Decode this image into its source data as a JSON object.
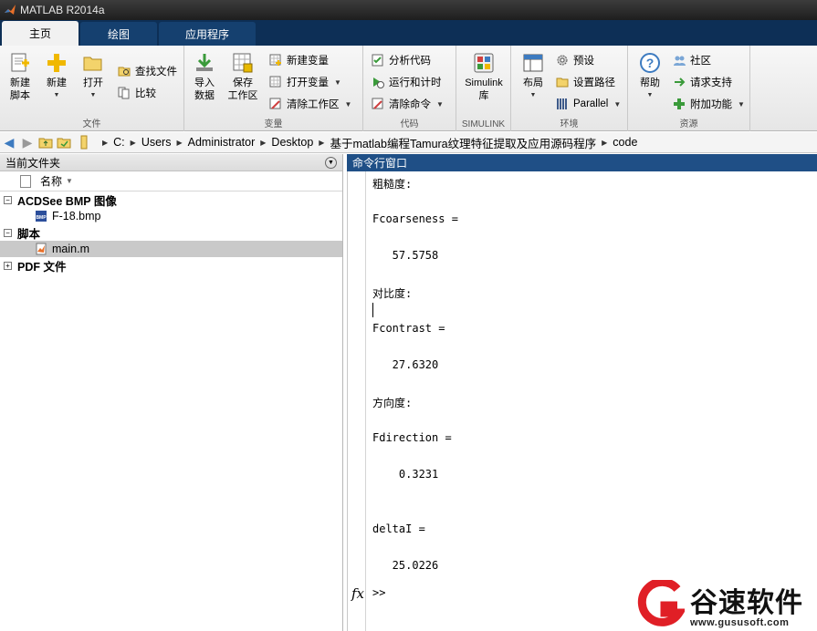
{
  "window": {
    "title": "MATLAB R2014a"
  },
  "tabs": [
    {
      "label": "主页",
      "active": true
    },
    {
      "label": "绘图",
      "active": false
    },
    {
      "label": "应用程序",
      "active": false
    }
  ],
  "ribbon": {
    "file": {
      "label": "文件",
      "new_script": "新建\n脚本",
      "new": "新建",
      "open": "打开",
      "find_files": "查找文件",
      "compare": "比较"
    },
    "variable": {
      "label": "变量",
      "import": "导入\n数据",
      "save_workspace": "保存\n工作区",
      "new_variable": "新建变量",
      "open_variable": "打开变量",
      "clear_workspace": "清除工作区"
    },
    "code": {
      "label": "代码",
      "analyze": "分析代码",
      "run_time": "运行和计时",
      "clear_commands": "清除命令"
    },
    "simulink": {
      "label": "SIMULINK",
      "library": "Simulink\n库"
    },
    "environment": {
      "label": "环境",
      "layout": "布局",
      "preferences": "预设",
      "set_path": "设置路径",
      "parallel": "Parallel"
    },
    "resources": {
      "label": "资源",
      "help": "帮助",
      "community": "社区",
      "support": "请求支持",
      "addons": "附加功能"
    }
  },
  "address": {
    "crumbs": [
      "C:",
      "Users",
      "Administrator",
      "Desktop",
      "基于matlab编程Tamura纹理特征提取及应用源码程序",
      "code"
    ]
  },
  "current_folder": {
    "title": "当前文件夹",
    "column_name": "名称",
    "groups": [
      {
        "name": "ACDSee BMP 图像",
        "expanded": true,
        "files": [
          {
            "name": "F-18.bmp",
            "selected": false
          }
        ]
      },
      {
        "name": "脚本",
        "expanded": true,
        "files": [
          {
            "name": "main.m",
            "selected": true
          }
        ]
      },
      {
        "name": "PDF 文件",
        "expanded": false,
        "files": []
      }
    ]
  },
  "command_window": {
    "title": "命令行窗口",
    "lines": [
      "粗糙度:",
      "Fcoarseness =",
      "   57.5758",
      "对比度:",
      "Fcontrast =",
      "   27.6320",
      "方向度:",
      "Fdirection =",
      "    0.3231",
      "deltaI =",
      "   25.0226"
    ],
    "fx_label": "fx",
    "prompt": ">>"
  },
  "watermark": {
    "title": "谷速软件",
    "url": "www.gususoft.com"
  },
  "colors": {
    "tab_bar": "#0d2f56",
    "cmd_header": "#1f4f86",
    "watermark_red": "#e01f26"
  }
}
